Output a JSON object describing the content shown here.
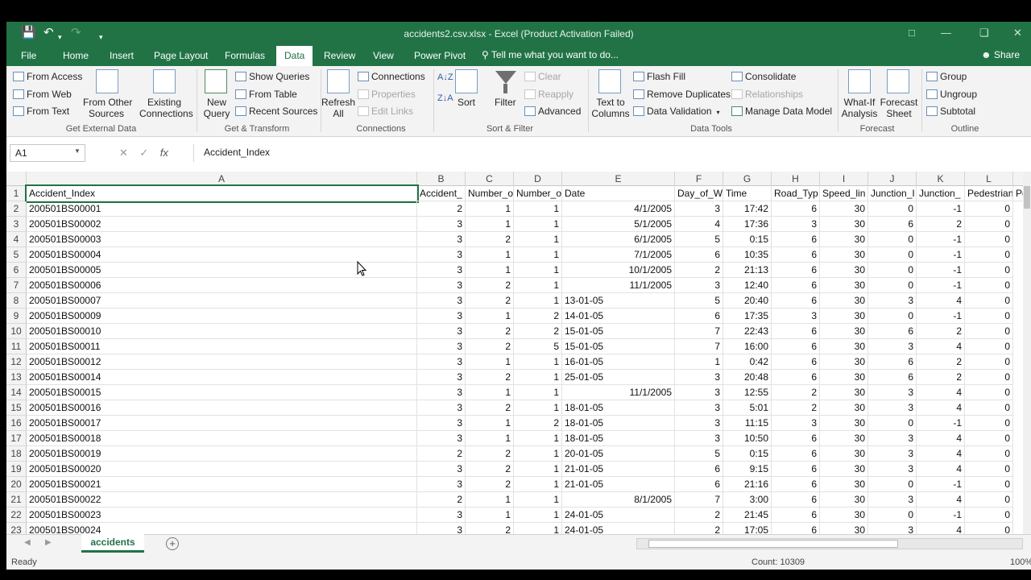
{
  "window": {
    "title": "accidents2.csv.xlsx - Excel (Product Activation Failed)",
    "accent_color": "#217346"
  },
  "tabs": [
    {
      "label": "File"
    },
    {
      "label": "Home"
    },
    {
      "label": "Insert"
    },
    {
      "label": "Page Layout"
    },
    {
      "label": "Formulas"
    },
    {
      "label": "Data"
    },
    {
      "label": "Review"
    },
    {
      "label": "View"
    },
    {
      "label": "Power Pivot"
    }
  ],
  "active_tab": "Data",
  "tell_me": "Tell me what you want to do...",
  "share": "Share",
  "ribbon": {
    "get_external": {
      "from_access": "From Access",
      "from_web": "From Web",
      "from_text": "From Text",
      "from_other_1": "From Other",
      "from_other_2": "Sources",
      "existing_1": "Existing",
      "existing_2": "Connections",
      "label": "Get External Data"
    },
    "get_transform": {
      "new_query_1": "New",
      "new_query_2": "Query",
      "show_queries": "Show Queries",
      "from_table": "From Table",
      "recent_sources": "Recent Sources",
      "label": "Get & Transform"
    },
    "connections": {
      "refresh_1": "Refresh",
      "refresh_2": "All",
      "connections": "Connections",
      "properties": "Properties",
      "edit_links": "Edit Links",
      "label": "Connections"
    },
    "sort_filter": {
      "sort": "Sort",
      "filter": "Filter",
      "clear": "Clear",
      "reapply": "Reapply",
      "advanced": "Advanced",
      "label": "Sort & Filter"
    },
    "data_tools": {
      "text_to_1": "Text to",
      "text_to_2": "Columns",
      "flash_fill": "Flash Fill",
      "remove_duplicates": "Remove Duplicates",
      "data_validation": "Data Validation",
      "consolidate": "Consolidate",
      "relationships": "Relationships",
      "manage_model": "Manage Data Model",
      "label": "Data Tools"
    },
    "forecast": {
      "whatif_1": "What-If",
      "whatif_2": "Analysis",
      "sheet_1": "Forecast",
      "sheet_2": "Sheet",
      "label": "Forecast"
    },
    "outline": {
      "group": "Group",
      "ungroup": "Ungroup",
      "subtotal": "Subtotal",
      "label": "Outline"
    }
  },
  "formula_bar": {
    "name_box": "A1",
    "value": "Accident_Index"
  },
  "columns": [
    "A",
    "B",
    "C",
    "D",
    "E",
    "F",
    "G",
    "H",
    "I",
    "J",
    "K",
    "L"
  ],
  "header_row": [
    "Accident_Index",
    "Accident_",
    "Number_o",
    "Number_o",
    "Date",
    "Day_of_W",
    "Time",
    "Road_Typ",
    "Speed_lin",
    "Junction_I",
    "Junction_",
    "Pedestrian",
    "Pe"
  ],
  "rows": [
    {
      "n": "2",
      "c": [
        "200501BS00001",
        "2",
        "1",
        "1",
        "4/1/2005",
        "3",
        "17:42",
        "6",
        "30",
        "0",
        "-1",
        "0"
      ]
    },
    {
      "n": "3",
      "c": [
        "200501BS00002",
        "3",
        "1",
        "1",
        "5/1/2005",
        "4",
        "17:36",
        "3",
        "30",
        "6",
        "2",
        "0"
      ]
    },
    {
      "n": "4",
      "c": [
        "200501BS00003",
        "3",
        "2",
        "1",
        "6/1/2005",
        "5",
        "0:15",
        "6",
        "30",
        "0",
        "-1",
        "0"
      ]
    },
    {
      "n": "5",
      "c": [
        "200501BS00004",
        "3",
        "1",
        "1",
        "7/1/2005",
        "6",
        "10:35",
        "6",
        "30",
        "0",
        "-1",
        "0"
      ]
    },
    {
      "n": "6",
      "c": [
        "200501BS00005",
        "3",
        "1",
        "1",
        "10/1/2005",
        "2",
        "21:13",
        "6",
        "30",
        "0",
        "-1",
        "0"
      ]
    },
    {
      "n": "7",
      "c": [
        "200501BS00006",
        "3",
        "2",
        "1",
        "11/1/2005",
        "3",
        "12:40",
        "6",
        "30",
        "0",
        "-1",
        "0"
      ]
    },
    {
      "n": "8",
      "c": [
        "200501BS00007",
        "3",
        "2",
        "1",
        "13-01-05",
        "5",
        "20:40",
        "6",
        "30",
        "3",
        "4",
        "0"
      ]
    },
    {
      "n": "9",
      "c": [
        "200501BS00009",
        "3",
        "1",
        "2",
        "14-01-05",
        "6",
        "17:35",
        "3",
        "30",
        "0",
        "-1",
        "0"
      ]
    },
    {
      "n": "10",
      "c": [
        "200501BS00010",
        "3",
        "2",
        "2",
        "15-01-05",
        "7",
        "22:43",
        "6",
        "30",
        "6",
        "2",
        "0"
      ]
    },
    {
      "n": "11",
      "c": [
        "200501BS00011",
        "3",
        "2",
        "5",
        "15-01-05",
        "7",
        "16:00",
        "6",
        "30",
        "3",
        "4",
        "0"
      ]
    },
    {
      "n": "12",
      "c": [
        "200501BS00012",
        "3",
        "1",
        "1",
        "16-01-05",
        "1",
        "0:42",
        "6",
        "30",
        "6",
        "2",
        "0"
      ]
    },
    {
      "n": "13",
      "c": [
        "200501BS00014",
        "3",
        "2",
        "1",
        "25-01-05",
        "3",
        "20:48",
        "6",
        "30",
        "6",
        "2",
        "0"
      ]
    },
    {
      "n": "14",
      "c": [
        "200501BS00015",
        "3",
        "1",
        "1",
        "11/1/2005",
        "3",
        "12:55",
        "2",
        "30",
        "3",
        "4",
        "0"
      ]
    },
    {
      "n": "15",
      "c": [
        "200501BS00016",
        "3",
        "2",
        "1",
        "18-01-05",
        "3",
        "5:01",
        "2",
        "30",
        "3",
        "4",
        "0"
      ]
    },
    {
      "n": "16",
      "c": [
        "200501BS00017",
        "3",
        "1",
        "2",
        "18-01-05",
        "3",
        "11:15",
        "3",
        "30",
        "0",
        "-1",
        "0"
      ]
    },
    {
      "n": "17",
      "c": [
        "200501BS00018",
        "3",
        "1",
        "1",
        "18-01-05",
        "3",
        "10:50",
        "6",
        "30",
        "3",
        "4",
        "0"
      ]
    },
    {
      "n": "18",
      "c": [
        "200501BS00019",
        "2",
        "2",
        "1",
        "20-01-05",
        "5",
        "0:15",
        "6",
        "30",
        "3",
        "4",
        "0"
      ]
    },
    {
      "n": "19",
      "c": [
        "200501BS00020",
        "3",
        "2",
        "1",
        "21-01-05",
        "6",
        "9:15",
        "6",
        "30",
        "3",
        "4",
        "0"
      ]
    },
    {
      "n": "20",
      "c": [
        "200501BS00021",
        "3",
        "2",
        "1",
        "21-01-05",
        "6",
        "21:16",
        "6",
        "30",
        "0",
        "-1",
        "0"
      ]
    },
    {
      "n": "21",
      "c": [
        "200501BS00022",
        "2",
        "1",
        "1",
        "8/1/2005",
        "7",
        "3:00",
        "6",
        "30",
        "3",
        "4",
        "0"
      ]
    },
    {
      "n": "22",
      "c": [
        "200501BS00023",
        "3",
        "1",
        "1",
        "24-01-05",
        "2",
        "21:45",
        "6",
        "30",
        "0",
        "-1",
        "0"
      ]
    },
    {
      "n": "23",
      "c": [
        "200501BS00024",
        "3",
        "2",
        "1",
        "24-01-05",
        "2",
        "17:05",
        "6",
        "30",
        "3",
        "4",
        "0"
      ]
    }
  ],
  "sheet_tab": "accidents",
  "status": {
    "ready": "Ready",
    "count": "Count: 10309",
    "zoom": "100%"
  }
}
